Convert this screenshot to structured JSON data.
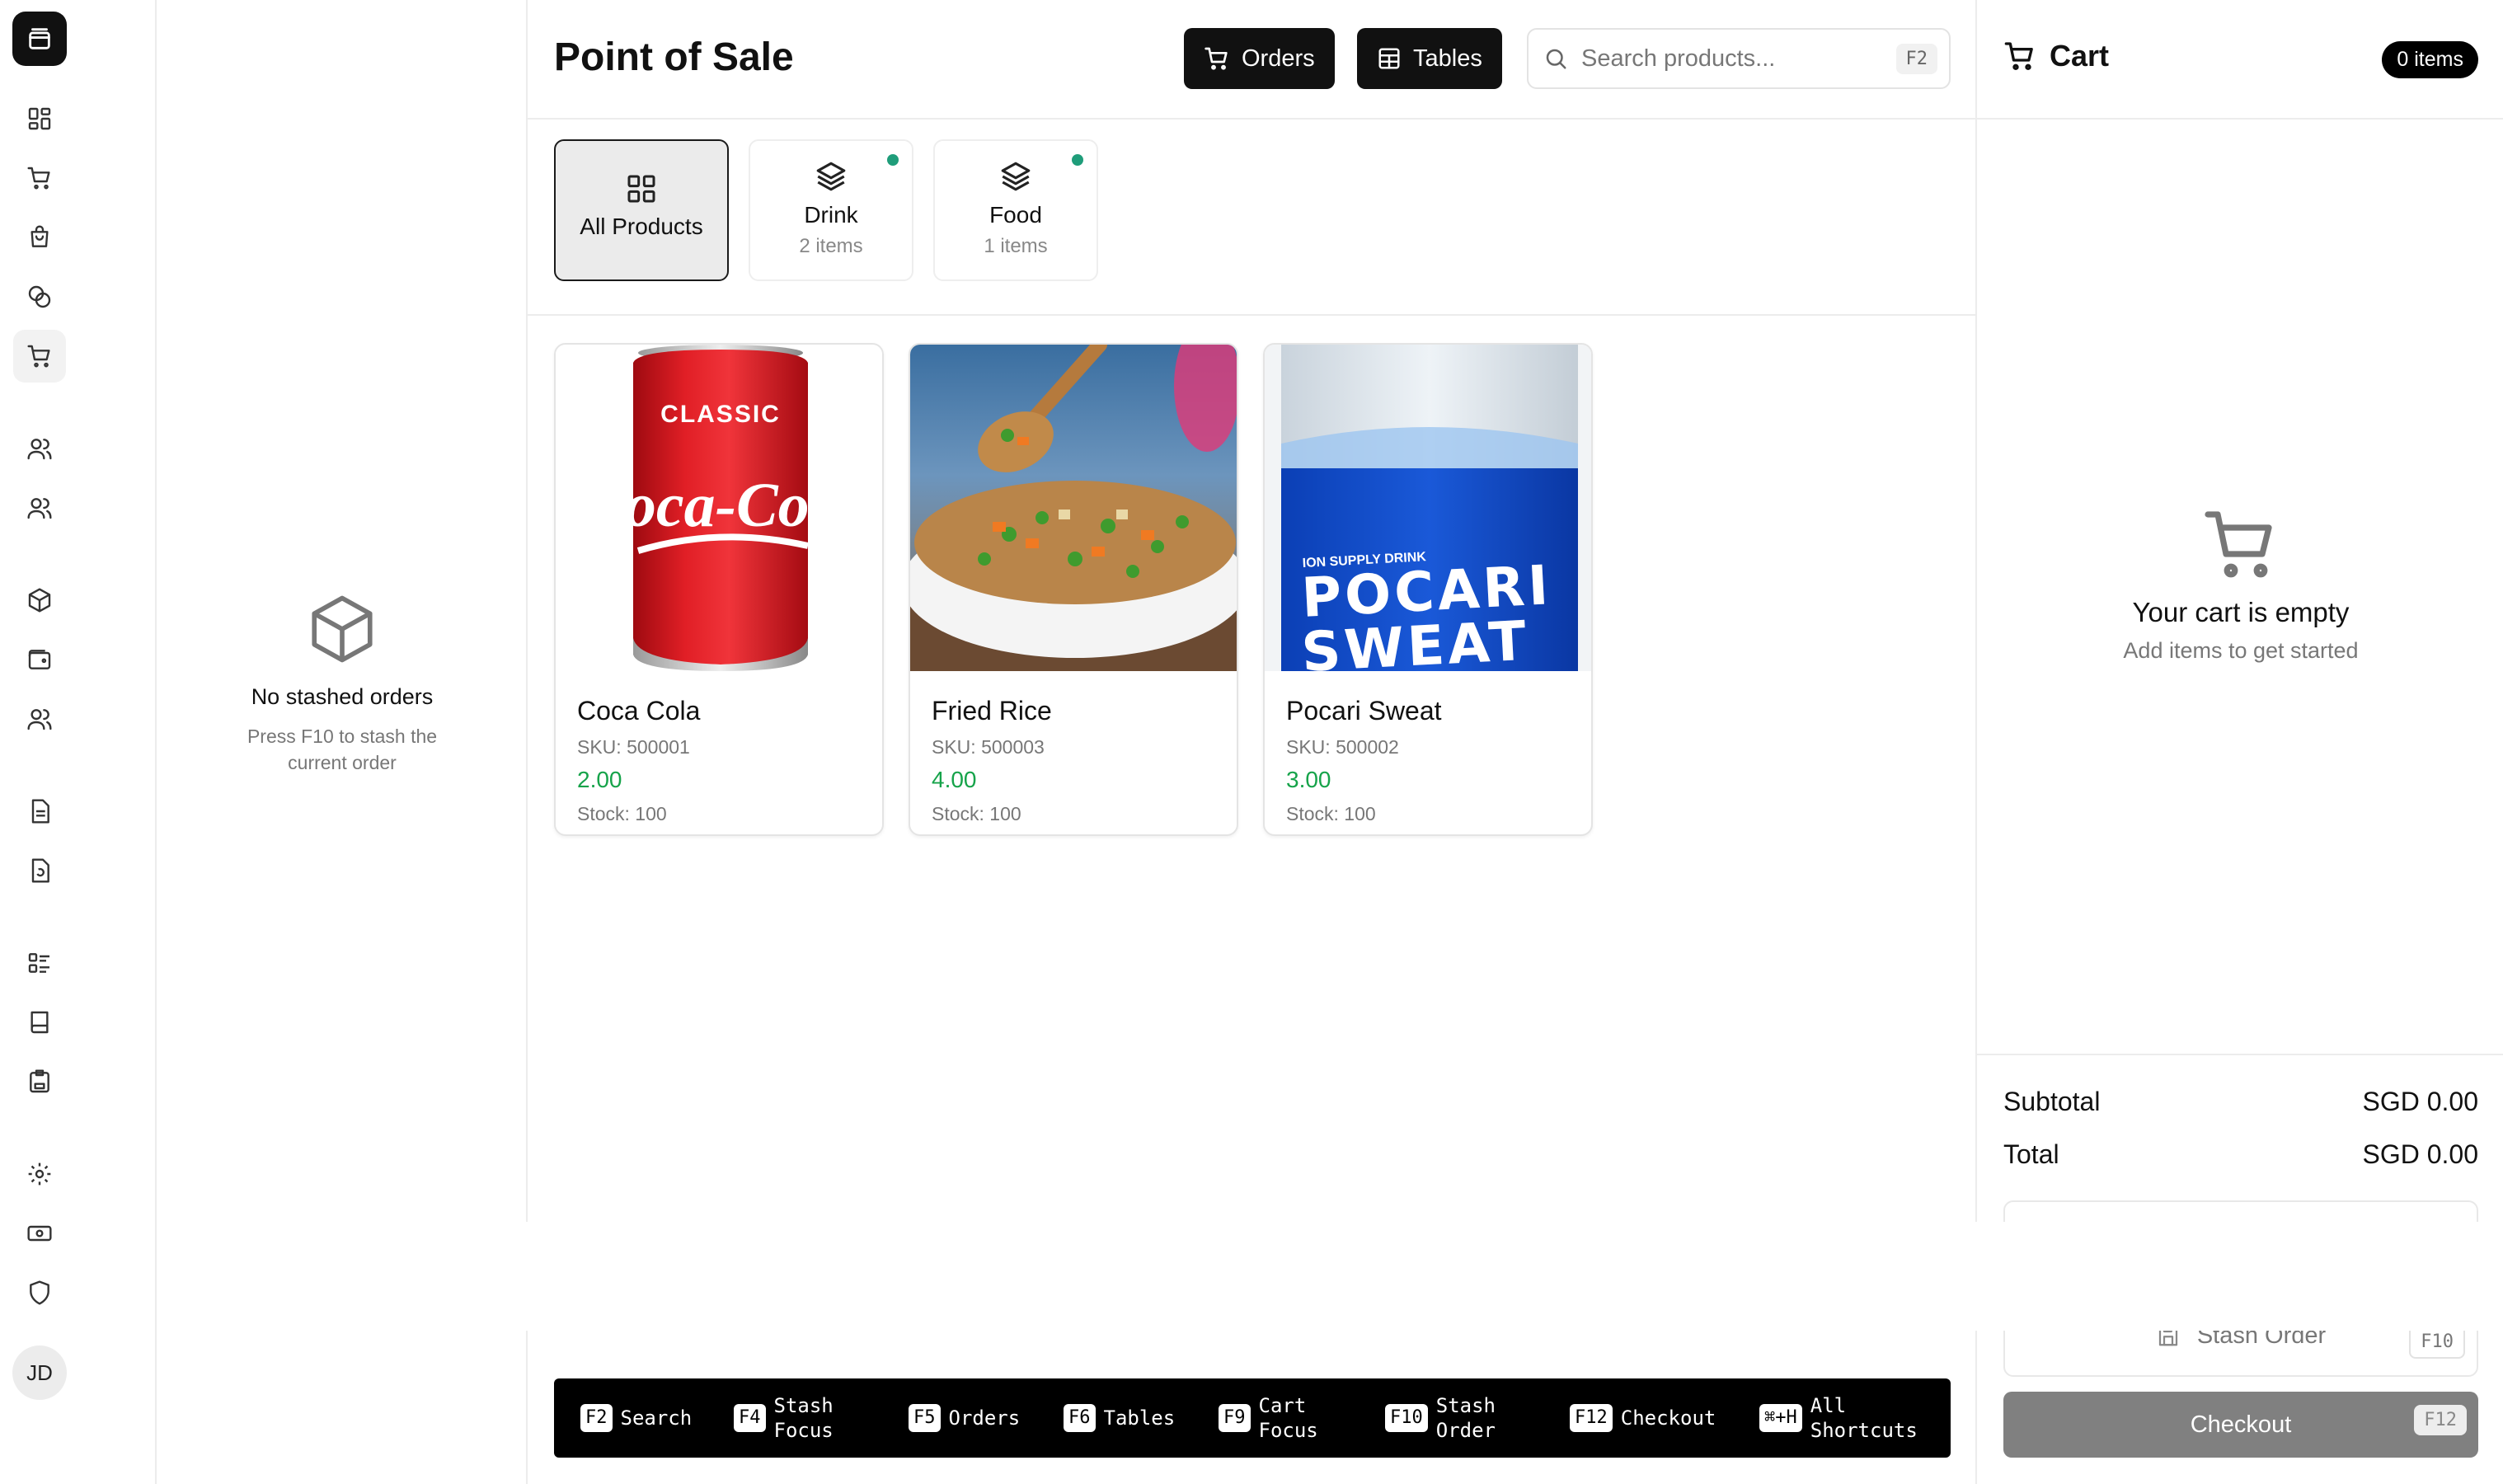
{
  "app": {
    "logo_icon": "layers-logo-icon",
    "accent": "#16a34a",
    "dot_color": "#1f9d7a"
  },
  "rail": {
    "items": [
      {
        "icon": "dashboard-grid-icon"
      },
      {
        "icon": "cart-icon"
      },
      {
        "icon": "shopping-bag-icon"
      },
      {
        "icon": "coins-icon"
      },
      {
        "icon": "cart-icon",
        "active": true
      },
      {
        "icon": "users-icon"
      },
      {
        "icon": "users-icon"
      },
      {
        "icon": "box-icon"
      },
      {
        "icon": "wallet-icon"
      },
      {
        "icon": "users-icon"
      },
      {
        "icon": "document-icon"
      },
      {
        "icon": "document-refresh-icon"
      },
      {
        "icon": "list-icon"
      },
      {
        "icon": "book-icon"
      },
      {
        "icon": "wallet-clipboard-icon"
      },
      {
        "icon": "settings-gear-icon"
      },
      {
        "icon": "cash-icon"
      },
      {
        "icon": "shield-icon"
      }
    ],
    "avatar": "JD"
  },
  "stash": {
    "empty_title": "No stashed orders",
    "empty_sub": "Press F10 to stash the current order"
  },
  "header": {
    "title": "Point of Sale",
    "orders_label": "Orders",
    "tables_label": "Tables",
    "search_placeholder": "Search products...",
    "search_key": "F2"
  },
  "categories": [
    {
      "name": "All Products",
      "count": "",
      "active": true
    },
    {
      "name": "Drink",
      "count": "2 items",
      "active": false
    },
    {
      "name": "Food",
      "count": "1 items",
      "active": false
    }
  ],
  "products": [
    {
      "name": "Coca Cola",
      "sku": "SKU: 500001",
      "price": "2.00",
      "stock": "Stock: 100"
    },
    {
      "name": "Fried Rice",
      "sku": "SKU: 500003",
      "price": "4.00",
      "stock": "Stock: 100"
    },
    {
      "name": "Pocari Sweat",
      "sku": "SKU: 500002",
      "price": "3.00",
      "stock": "Stock: 100"
    }
  ],
  "product_images": {
    "coca_cola_brand": "Coca-Cola",
    "coca_cola_top": "CLASSIC",
    "pocari_small": "ION SUPPLY DRINK",
    "pocari_1": "POCARI",
    "pocari_2": "SWEAT"
  },
  "shortcuts": [
    {
      "key": "F2",
      "label": "Search"
    },
    {
      "key": "F4",
      "label": "Stash Focus"
    },
    {
      "key": "F5",
      "label": "Orders"
    },
    {
      "key": "F6",
      "label": "Tables"
    },
    {
      "key": "F9",
      "label": "Cart Focus"
    },
    {
      "key": "F10",
      "label": "Stash Order"
    },
    {
      "key": "F12",
      "label": "Checkout"
    },
    {
      "key": "⌘+H",
      "label": "All Shortcuts"
    }
  ],
  "cart": {
    "title": "Cart",
    "badge": "0 items",
    "empty_title": "Your cart is empty",
    "empty_sub": "Add items to get started",
    "subtotal_label": "Subtotal",
    "subtotal_value": "SGD 0.00",
    "total_label": "Total",
    "total_value": "SGD 0.00",
    "stash_label": "Stash Order",
    "stash_key": "F10",
    "checkout_label": "Checkout",
    "checkout_key": "F12"
  }
}
